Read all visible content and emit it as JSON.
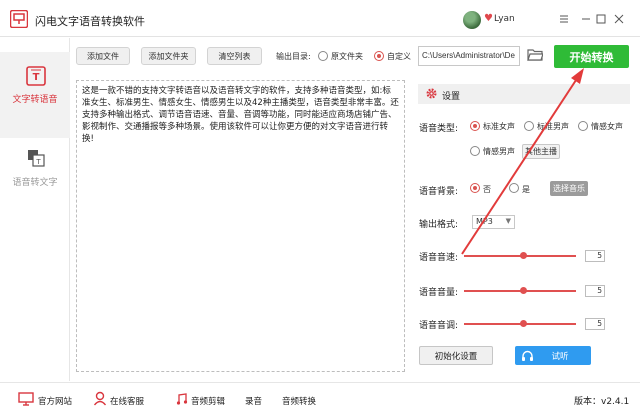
{
  "app": {
    "title": "闪电文字语音转换软件",
    "user_name": "Lyan"
  },
  "window_controls": [
    "menu-icon",
    "minimize-icon",
    "maximize-icon",
    "close-icon"
  ],
  "sidebar": {
    "items": [
      {
        "label": "文字转语音",
        "icon": "text-to-speech-icon",
        "active": true
      },
      {
        "label": "语音转文字",
        "icon": "speech-to-text-icon",
        "active": false
      }
    ]
  },
  "toolbar": {
    "add_file": "添加文件",
    "add_folder": "添加文件夹",
    "clear_list": "清空列表",
    "output_label": "输出目录:",
    "output_options": [
      "原文件夹",
      "自定义"
    ],
    "output_selected": "自定义",
    "output_path": "C:\\Users\\Administrator\\De",
    "start_button": "开始转换"
  },
  "editor": {
    "text": "这是一款不错的支持文字转语音以及语音转文字的软件，支持多种语音类型，如:标准女生、标准男生、情感女生、情感男生以及42种主播类型，语音类型非常丰富。还支持多种输出格式、调节语音语速、音量、音调等功能，同时能适应商场店铺广告、影视制作、交通播报等多种场景。使用该软件可以让你更方便的对文字语音进行转换!"
  },
  "settings": {
    "title": "设置",
    "voice_type_label": "语音类型:",
    "voice_types": [
      "标准女声",
      "标准男声",
      "情感女声",
      "情感男声"
    ],
    "voice_selected": "标准女声",
    "other_anchor": "其他主播",
    "bg_label": "语音背景:",
    "bg_options": [
      "否",
      "是"
    ],
    "bg_selected": "否",
    "choose_music": "选择音乐",
    "format_label": "输出格式:",
    "format_value": "MP3",
    "speed_label": "语音音速:",
    "speed_value": "5",
    "volume_label": "语音音量:",
    "volume_value": "5",
    "pitch_label": "语音音调:",
    "pitch_value": "5",
    "reset_button": "初始化设置",
    "listen_button": "试听"
  },
  "statusbar": {
    "items": [
      "官方网站",
      "在线客服",
      "音频剪辑",
      "录音",
      "音频转换"
    ],
    "version": "版本：v2.4.1"
  },
  "colors": {
    "accent_red": "#d9534f",
    "start_green": "#2fbb37",
    "listen_blue": "#2f9bf0"
  }
}
